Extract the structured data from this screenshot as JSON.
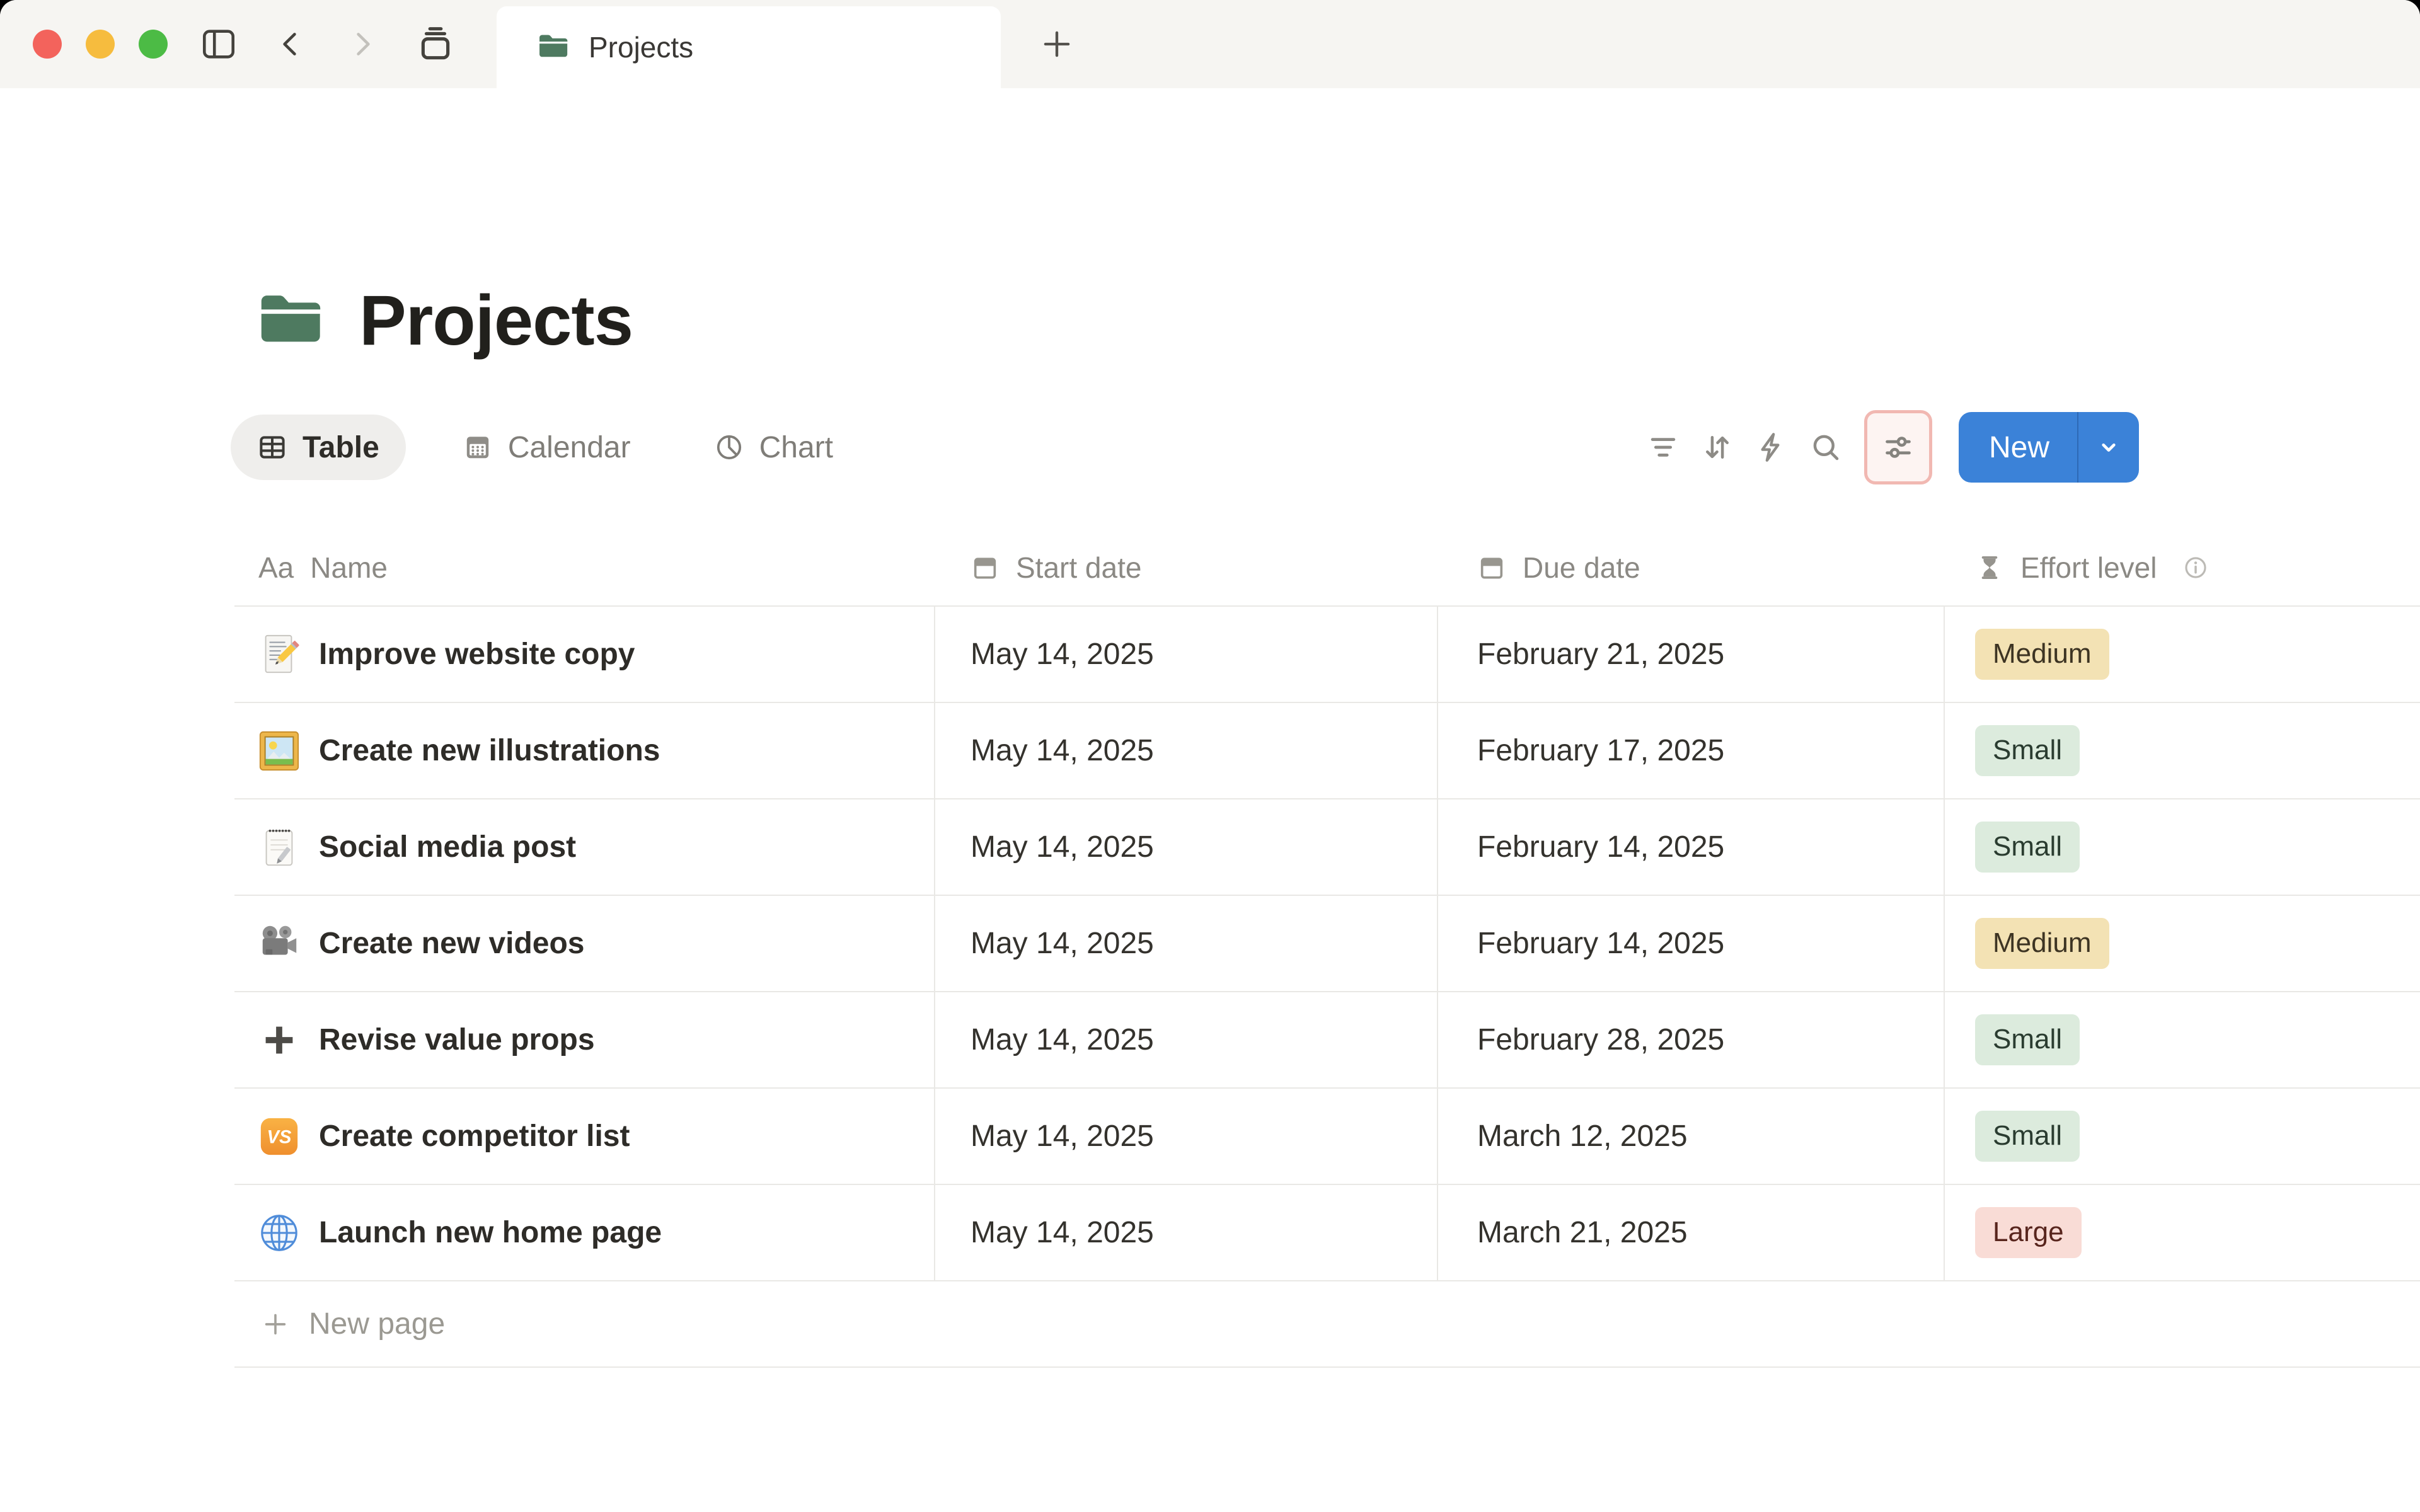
{
  "window": {
    "traffic_lights": [
      "close",
      "minimize",
      "zoom"
    ],
    "tab": {
      "label": "Projects"
    }
  },
  "page": {
    "title": "Projects",
    "views": [
      {
        "label": "Table",
        "active": true
      },
      {
        "label": "Calendar",
        "active": false
      },
      {
        "label": "Chart",
        "active": false
      }
    ],
    "toolbar": {
      "new_label": "New"
    }
  },
  "table": {
    "columns": [
      {
        "label": "Name",
        "icon": "text-icon",
        "icon_glyph": "Aa"
      },
      {
        "label": "Start date",
        "icon": "calendar-icon"
      },
      {
        "label": "Due date",
        "icon": "calendar-icon"
      },
      {
        "label": "Effort level",
        "icon": "hourglass-icon",
        "has_info": true
      }
    ],
    "rows": [
      {
        "icon": "memo-emoji",
        "name": "Improve website copy",
        "start_date": "May 14, 2025",
        "due_date": "February 21, 2025",
        "effort": "Medium",
        "effort_color": "yellow"
      },
      {
        "icon": "framed-picture-emoji",
        "name": "Create new illustrations",
        "start_date": "May 14, 2025",
        "due_date": "February 17, 2025",
        "effort": "Small",
        "effort_color": "green"
      },
      {
        "icon": "spiral-notepad-emoji",
        "name": "Social media post",
        "start_date": "May 14, 2025",
        "due_date": "February 14, 2025",
        "effort": "Small",
        "effort_color": "green"
      },
      {
        "icon": "movie-camera-emoji",
        "name": "Create new videos",
        "start_date": "May 14, 2025",
        "due_date": "February 14, 2025",
        "effort": "Medium",
        "effort_color": "yellow"
      },
      {
        "icon": "plus-emoji",
        "name": "Revise value props",
        "start_date": "May 14, 2025",
        "due_date": "February 28, 2025",
        "effort": "Small",
        "effort_color": "green"
      },
      {
        "icon": "vs-emoji",
        "icon_text": "VS",
        "name": "Create competitor list",
        "start_date": "May 14, 2025",
        "due_date": "March 12, 2025",
        "effort": "Small",
        "effort_color": "green"
      },
      {
        "icon": "globe-emoji",
        "name": "Launch new home page",
        "start_date": "May 14, 2025",
        "due_date": "March 21, 2025",
        "effort": "Large",
        "effort_color": "red"
      }
    ],
    "new_page_label": "New page"
  },
  "colors": {
    "accent_blue": "#3b82d8",
    "highlight_border": "#f1b8b2",
    "badge_yellow_bg": "#f3e2b4",
    "badge_green_bg": "#dcebdd",
    "badge_red_bg": "#f9dcd6",
    "folder_green": "#4e7a60"
  }
}
